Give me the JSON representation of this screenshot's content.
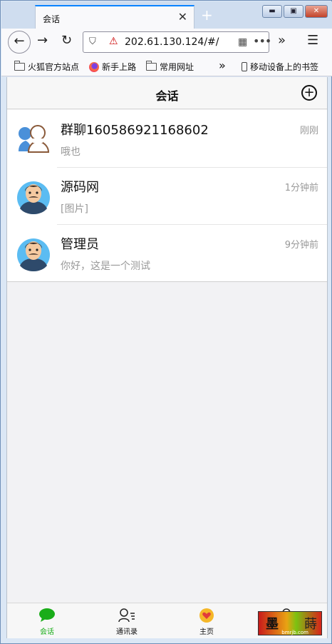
{
  "browser": {
    "tab_title": "会话",
    "tab_close": "✕",
    "new_tab": "+",
    "window_buttons": {
      "minimize": "▬",
      "maximize": "▣",
      "close": "✕"
    },
    "url": "202.61.130.124/#/",
    "bookmarks": [
      {
        "label": "火狐官方站点",
        "icon": "folder-icon"
      },
      {
        "label": "新手上路",
        "icon": "firefox-logo-icon"
      },
      {
        "label": "常用网址",
        "icon": "folder-icon"
      }
    ],
    "mobile_bookmarks": "移动设备上的书签"
  },
  "app": {
    "title": "会话",
    "add_button": "+",
    "conversations": [
      {
        "name": "群聊160586921168602",
        "time": "刚刚",
        "message": "哦也",
        "avatar": "group-avatar-icon"
      },
      {
        "name": "源码网",
        "time": "1分钟前",
        "message": "[图片]",
        "avatar": "user-avatar-icon"
      },
      {
        "name": "管理员",
        "time": "9分钟前",
        "message": "你好，这是一个测试",
        "avatar": "user-avatar-icon"
      }
    ],
    "tabs": [
      {
        "label": "会话",
        "icon": "chat-bubble-icon",
        "active": true
      },
      {
        "label": "通讯录",
        "icon": "contacts-icon",
        "active": false
      },
      {
        "label": "主页",
        "icon": "heart-icon",
        "active": false
      },
      {
        "label": "",
        "icon": "profile-icon",
        "active": false
      }
    ]
  },
  "watermark": {
    "main": "墨",
    "right": "蒔",
    "sub": "bmrjb.com"
  },
  "colors": {
    "accent_green": "#1aad19",
    "firefox_blue": "#0a84ff",
    "secondary_text": "#999999"
  }
}
